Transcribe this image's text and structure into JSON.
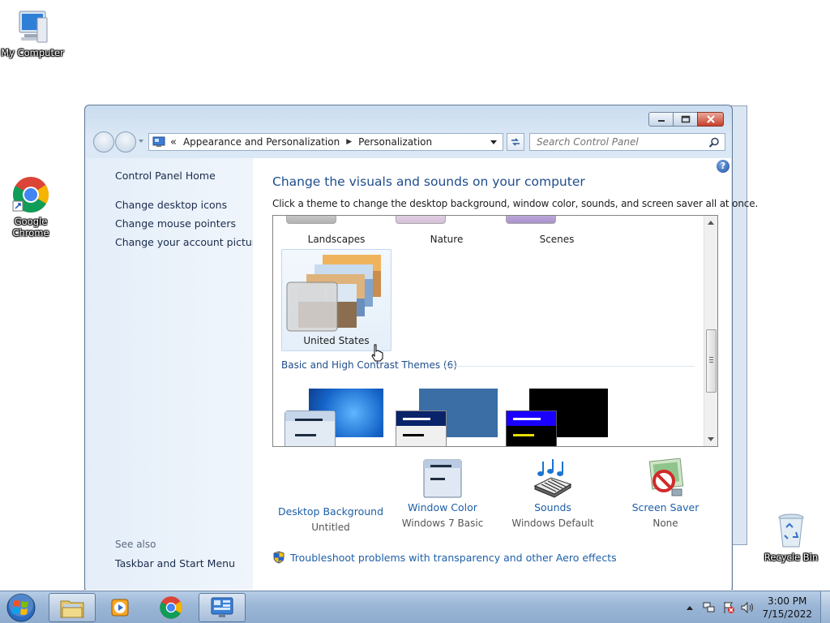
{
  "desktop": {
    "icons": [
      {
        "label": "My Computer"
      },
      {
        "label": "Google Chrome"
      },
      {
        "label": "Recycle Bin"
      }
    ]
  },
  "window": {
    "address": {
      "prefix": "«",
      "crumbs": [
        "Appearance and Personalization",
        "Personalization"
      ]
    },
    "search": {
      "placeholder": "Search Control Panel"
    },
    "sidebar": {
      "home": "Control Panel Home",
      "links": [
        "Change desktop icons",
        "Change mouse pointers",
        "Change your account picture"
      ],
      "see_also_label": "See also",
      "see_also_links": [
        "Taskbar and Start Menu"
      ]
    },
    "content": {
      "title": "Change the visuals and sounds on your computer",
      "subtitle": "Click a theme to change the desktop background, window color, sounds, and screen saver all at once.",
      "themes_top": [
        "Landscapes",
        "Nature",
        "Scenes"
      ],
      "selected_theme": "United States",
      "basic_section": "Basic and High Contrast Themes (6)",
      "bottom": [
        {
          "title": "Desktop Background",
          "value": "Untitled"
        },
        {
          "title": "Window Color",
          "value": "Windows 7 Basic"
        },
        {
          "title": "Sounds",
          "value": "Windows Default"
        },
        {
          "title": "Screen Saver",
          "value": "None"
        }
      ],
      "troubleshoot": "Troubleshoot problems with transparency and other Aero effects"
    }
  },
  "taskbar": {
    "time": "3:00 PM",
    "date": "7/15/2022"
  },
  "colors": {
    "link": "#1d5fa8",
    "title": "#1e4d8c",
    "taskbar": "#9bb6d6"
  }
}
